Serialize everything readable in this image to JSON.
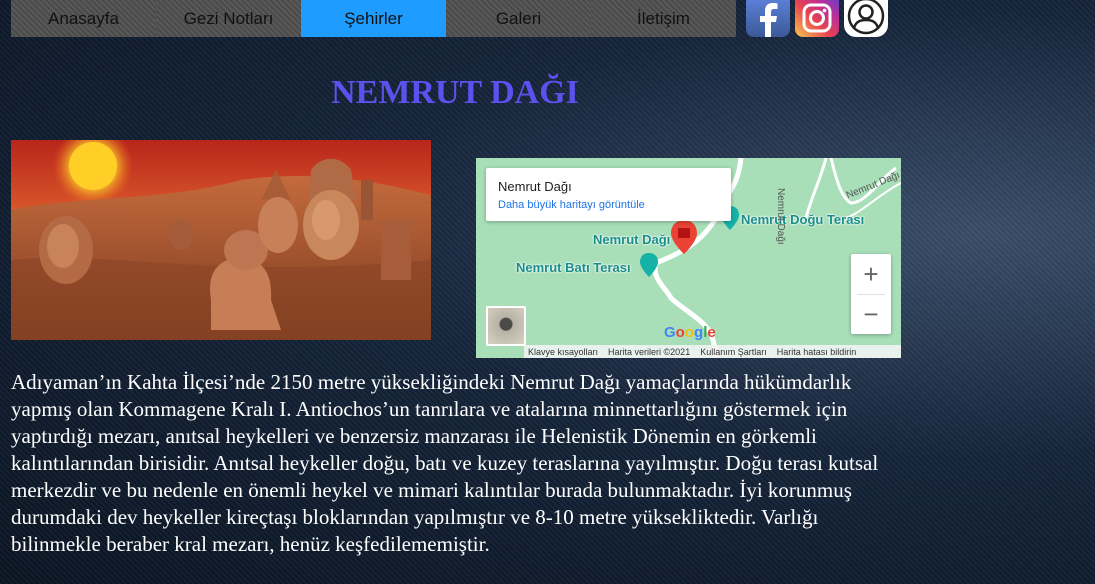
{
  "nav": {
    "items": [
      {
        "label": "Anasayfa",
        "active": false
      },
      {
        "label": "Gezi Notları",
        "active": false
      },
      {
        "label": "Şehirler",
        "active": true
      },
      {
        "label": "Galeri",
        "active": false
      },
      {
        "label": "İletişim",
        "active": false
      }
    ]
  },
  "social": {
    "facebook": "facebook-icon",
    "instagram": "instagram-icon",
    "user": "user-icon"
  },
  "page": {
    "title": "NEMRUT DAĞI",
    "title_color": "#5b52ee",
    "accent_nav": "#1e9cff"
  },
  "map": {
    "card_title": "Nemrut Dağı",
    "card_link": "Daha büyük haritayı görüntüle",
    "labels": {
      "summit": "Nemrut Dağı",
      "east": "Nemrut Doğu Terası",
      "west": "Nemrut Batı Terası"
    },
    "road_label_1": "Nemrut Dağı",
    "road_label_2": "Nemrut Dağı Yolu",
    "zoom_in": "+",
    "zoom_out": "−",
    "brand": "Google",
    "attribution": [
      "Klavye kısayolları",
      "Harita verileri ©2021",
      "Kullanım Şartları",
      "Harita hatası bildirin"
    ]
  },
  "content": {
    "paragraph": "Adıyaman’ın Kahta İlçesi’nde 2150 metre yüksekliğindeki Nemrut Dağı yamaçlarında hükümdarlık yapmış olan Kommagene Kralı I. Antiochos’un tanrılara ve atalarına minnettarlığını göstermek için yaptırdığı mezarı, anıtsal heykelleri ve benzersiz manzarası ile Helenistik Dönemin en görkemli kalıntılarından birisidir. Anıtsal heykeller doğu, batı ve kuzey teraslarına yayılmıştır. Doğu terası kutsal merkezdir ve bu nedenle en önemli heykel ve mimari kalıntılar burada bulunmaktadır. İyi korunmuş durumdaki dev heykeller kireçtaşı bloklarından yapılmıştır ve 8-10 metre yüksekliktedir. Varlığı bilinmekle beraber kral mezarı, henüz keşfedilememiştir."
  }
}
